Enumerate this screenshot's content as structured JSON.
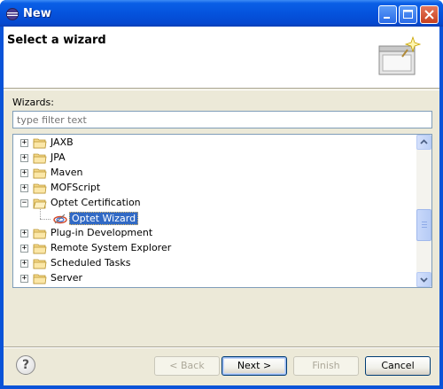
{
  "window": {
    "title": "New",
    "icon": "eclipse-icon"
  },
  "banner": {
    "title": "Select a wizard",
    "image_icon": "wizard-banner-icon"
  },
  "wizards": {
    "label": "Wizards:",
    "filter_placeholder": "type filter text",
    "filter_value": ""
  },
  "tree": {
    "items": [
      {
        "label": "JAXB",
        "expanded": false,
        "type": "folder"
      },
      {
        "label": "JPA",
        "expanded": false,
        "type": "folder"
      },
      {
        "label": "Maven",
        "expanded": false,
        "type": "folder"
      },
      {
        "label": "MOFScript",
        "expanded": false,
        "type": "folder"
      },
      {
        "label": "Optet Certification",
        "expanded": true,
        "type": "folder"
      },
      {
        "label": "Optet Wizard",
        "type": "wizard",
        "selected": true
      },
      {
        "label": "Plug-in Development",
        "expanded": false,
        "type": "folder"
      },
      {
        "label": "Remote System Explorer",
        "expanded": false,
        "type": "folder"
      },
      {
        "label": "Scheduled Tasks",
        "expanded": false,
        "type": "folder"
      },
      {
        "label": "Server",
        "expanded": false,
        "type": "folder"
      }
    ]
  },
  "buttons": {
    "help": "?",
    "back": "< Back",
    "next": "Next >",
    "finish": "Finish",
    "cancel": "Cancel"
  },
  "colors": {
    "titlebar": "#0553dd",
    "dialog_bg": "#ece9d8",
    "selection": "#316ac5"
  }
}
